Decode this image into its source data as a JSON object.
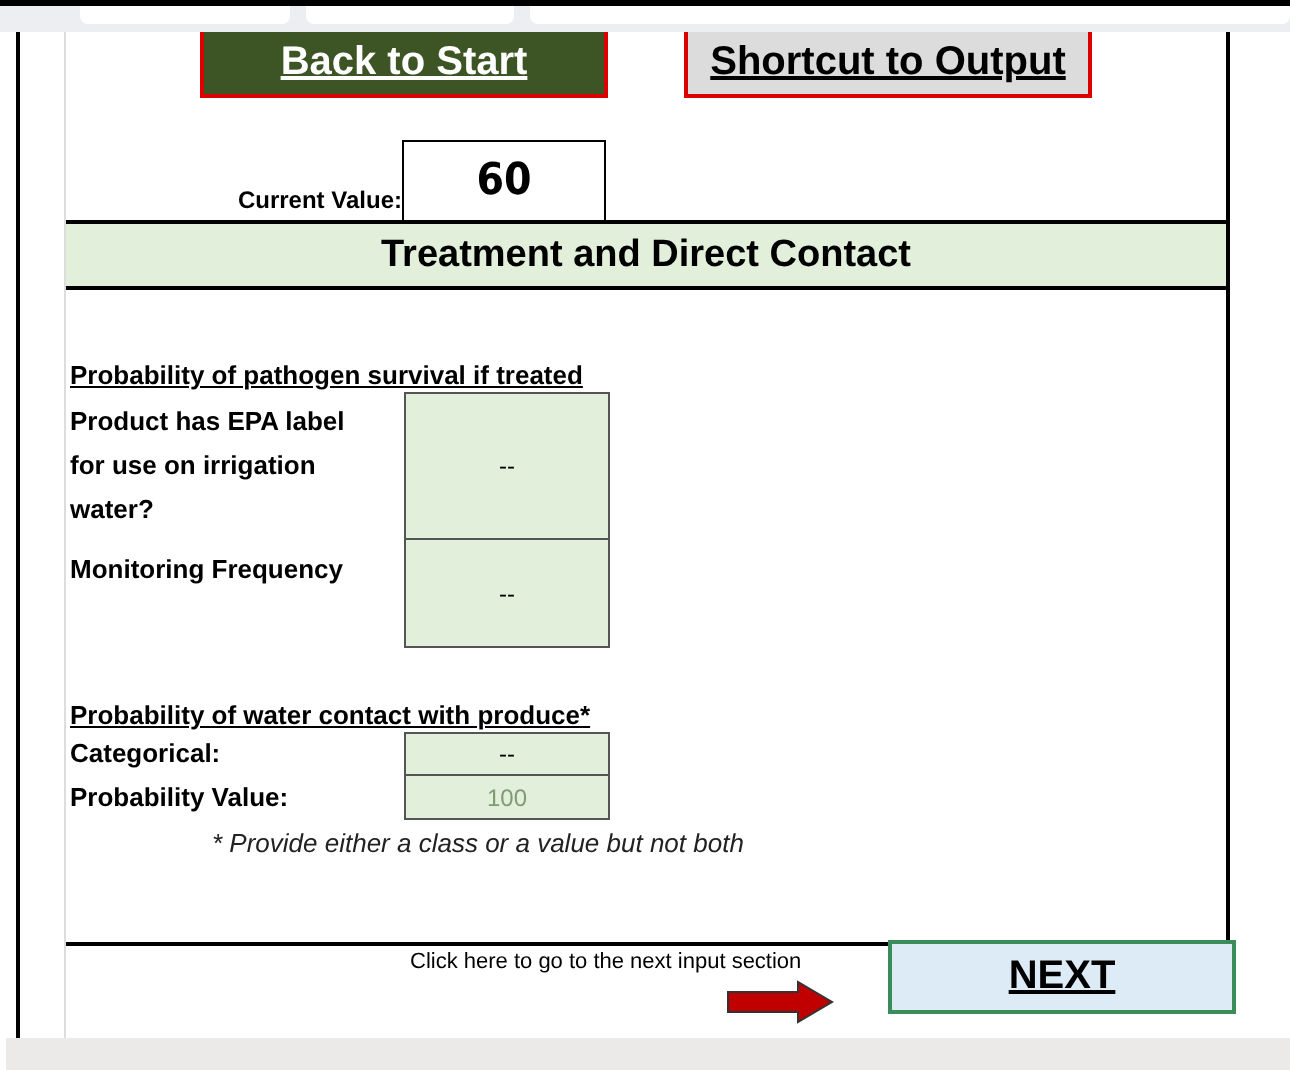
{
  "nav_buttons": [
    {
      "label": "Back to Start",
      "kind": "dark"
    },
    {
      "label": "Shortcut to Output",
      "kind": "light"
    }
  ],
  "current_value": {
    "label": "Current Value:",
    "value": "60"
  },
  "section_title": "Treatment and Direct Contact",
  "treatment": {
    "title": "Probability of pathogen survival if treated",
    "fields": [
      {
        "label": "Product has EPA label for use on irrigation water?",
        "value": "--",
        "kind": "tall"
      },
      {
        "label": "Monitoring Frequency",
        "value": "--",
        "kind": "short"
      }
    ]
  },
  "contact": {
    "title": "Probability of water contact with produce*",
    "fields": [
      {
        "label": "Categorical:",
        "value": "--",
        "faint": false
      },
      {
        "label": "Probability Value:",
        "value": "100",
        "faint": true
      }
    ],
    "note": "* Provide either a class or a value but not both"
  },
  "footer": {
    "hint": "Click here to go to the next input section",
    "next_button": "NEXT"
  }
}
